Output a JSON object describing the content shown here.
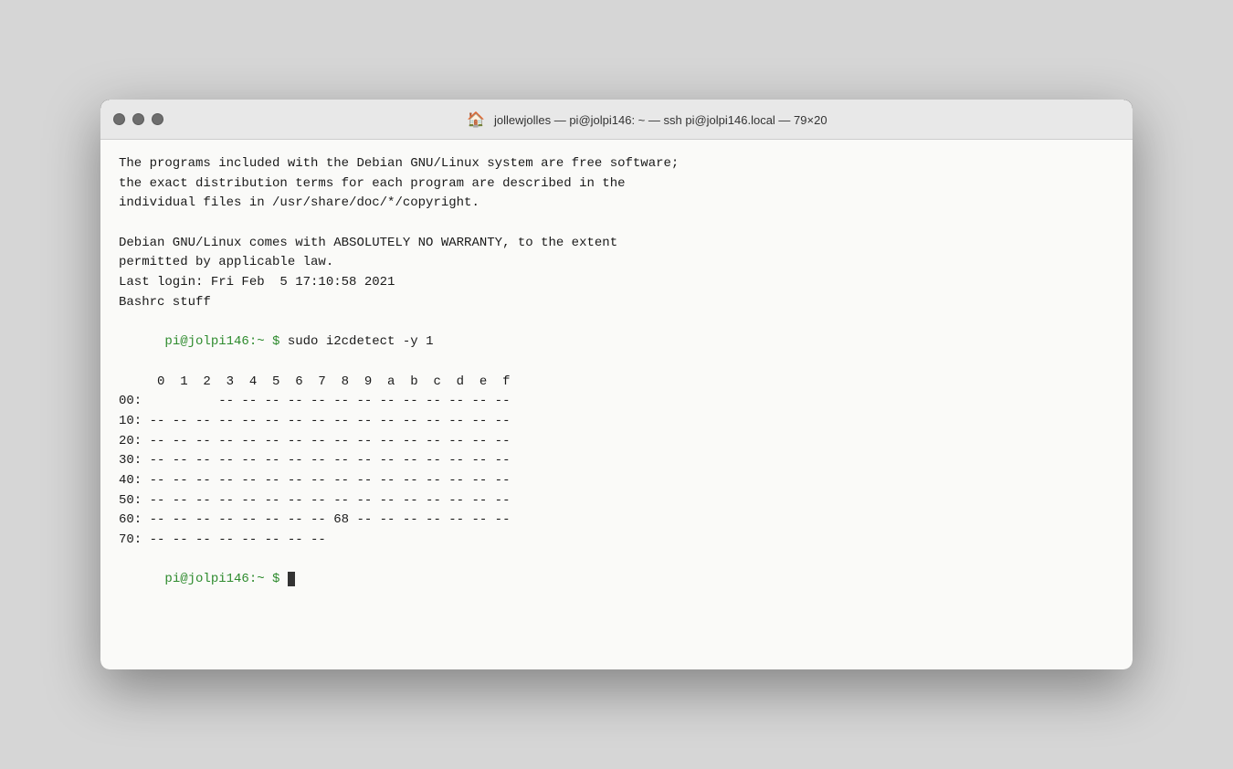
{
  "window": {
    "title": "jollewjolles — pi@jolpi146: ~ — ssh pi@jolpi146.local — 79×20",
    "title_icon": "🏠"
  },
  "terminal": {
    "lines": [
      {
        "type": "text",
        "content": "The programs included with the Debian GNU/Linux system are free software;"
      },
      {
        "type": "text",
        "content": "the exact distribution terms for each program are described in the"
      },
      {
        "type": "text",
        "content": "individual files in /usr/share/doc/*/copyright."
      },
      {
        "type": "empty"
      },
      {
        "type": "text",
        "content": "Debian GNU/Linux comes with ABSOLUTELY NO WARRANTY, to the extent"
      },
      {
        "type": "text",
        "content": "permitted by applicable law."
      },
      {
        "type": "text",
        "content": "Last login: Fri Feb  5 17:10:58 2021"
      },
      {
        "type": "text",
        "content": "Bashrc stuff"
      },
      {
        "type": "command",
        "prompt": "pi@jolpi146:~ $ ",
        "cmd": "sudo i2cdetect -y 1"
      },
      {
        "type": "text",
        "content": "     0  1  2  3  4  5  6  7  8  9  a  b  c  d  e  f"
      },
      {
        "type": "text",
        "content": "00:          -- -- -- -- -- -- -- -- -- -- -- -- -- "
      },
      {
        "type": "text",
        "content": "10: -- -- -- -- -- -- -- -- -- -- -- -- -- -- -- --"
      },
      {
        "type": "text",
        "content": "20: -- -- -- -- -- -- -- -- -- -- -- -- -- -- -- --"
      },
      {
        "type": "text",
        "content": "30: -- -- -- -- -- -- -- -- -- -- -- -- -- -- -- --"
      },
      {
        "type": "text",
        "content": "40: -- -- -- -- -- -- -- -- -- -- -- -- -- -- -- --"
      },
      {
        "type": "text",
        "content": "50: -- -- -- -- -- -- -- -- -- -- -- -- -- -- -- --"
      },
      {
        "type": "text",
        "content": "60: -- -- -- -- -- -- -- -- 68 -- -- -- -- -- -- --"
      },
      {
        "type": "text",
        "content": "70: -- -- -- -- -- -- -- --"
      },
      {
        "type": "prompt_only",
        "prompt": "pi@jolpi146:~ $ "
      }
    ]
  }
}
